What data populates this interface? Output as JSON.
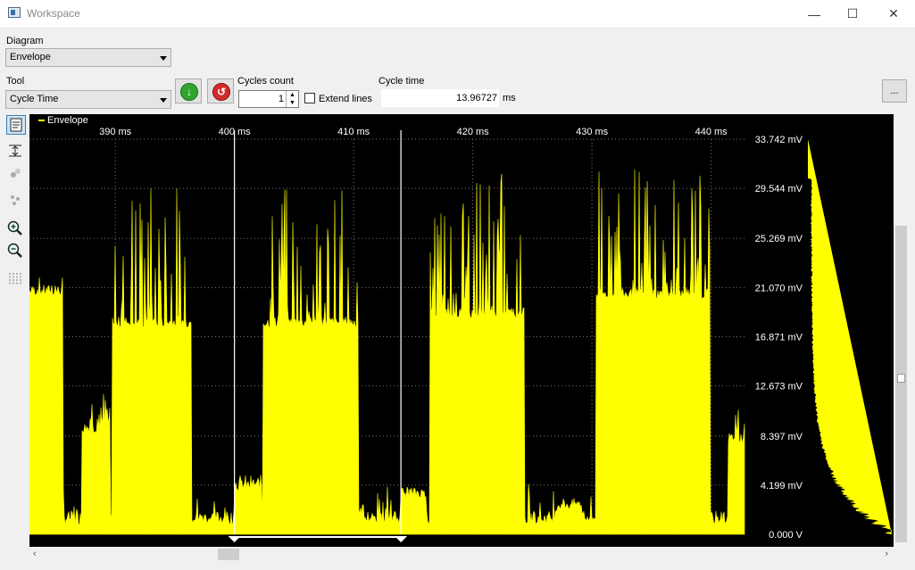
{
  "window": {
    "title": "Workspace",
    "minimize": "—",
    "maximize": "☐",
    "close": "✕"
  },
  "diagram": {
    "label": "Diagram",
    "value": "Envelope"
  },
  "tool": {
    "label": "Tool",
    "value": "Cycle Time"
  },
  "cycles": {
    "label": "Cycles count",
    "value": "1"
  },
  "extend_lines": {
    "label": "Extend lines",
    "checked": false
  },
  "cycle_time": {
    "label": "Cycle time",
    "value": "13.96727",
    "unit": "ms"
  },
  "more_button": "...",
  "icons": {
    "apply": "green-down-arrow-icon",
    "reset": "red-undo-icon"
  },
  "colors": {
    "series": "#ffff00",
    "background": "#000000",
    "text": "#ffffff"
  },
  "chart_data": {
    "type": "area",
    "legend": [
      "Envelope"
    ],
    "legend_position": "top-left",
    "x_unit": "ms",
    "x_ticks": [
      "390 ms",
      "400 ms",
      "410 ms",
      "420 ms",
      "430 ms",
      "440 ms"
    ],
    "x_tick_values": [
      390,
      400,
      410,
      420,
      430,
      440
    ],
    "xlim": [
      382.8,
      442.8
    ],
    "y_ticks": [
      "33.742 mV",
      "29.544 mV",
      "25.269 mV",
      "21.070 mV",
      "16.871 mV",
      "12.673 mV",
      "8.397 mV",
      "4.199 mV",
      "0.000 V"
    ],
    "y_tick_values": [
      33.742,
      29.544,
      25.269,
      21.07,
      16.871,
      12.673,
      8.397,
      4.199,
      0
    ],
    "ylim": [
      0,
      33.742
    ],
    "grid": true,
    "cursors_ms": [
      400,
      413.97
    ],
    "bursts": [
      {
        "start": 382.8,
        "end": 385.6,
        "level": 20.3,
        "peak": 22.0
      },
      {
        "start": 387.2,
        "end": 389.6,
        "level": 8.6,
        "peak": 12.6
      },
      {
        "start": 389.7,
        "end": 396.4,
        "level": 17.6,
        "peak": 30.2
      },
      {
        "start": 400.0,
        "end": 402.3,
        "level": 3.7,
        "peak": 5.1
      },
      {
        "start": 402.4,
        "end": 410.4,
        "level": 17.6,
        "peak": 29.8
      },
      {
        "start": 413.9,
        "end": 416.1,
        "level": 3.1,
        "peak": 4.0
      },
      {
        "start": 416.4,
        "end": 424.3,
        "level": 18.4,
        "peak": 31.2
      },
      {
        "start": 427.0,
        "end": 429.1,
        "level": 2.1,
        "peak": 3.0
      },
      {
        "start": 430.3,
        "end": 439.9,
        "level": 20.0,
        "peak": 31.6
      },
      {
        "start": 441.4,
        "end": 442.8,
        "level": 7.7,
        "peak": 10.8
      }
    ],
    "histogram_shape": "decay"
  }
}
